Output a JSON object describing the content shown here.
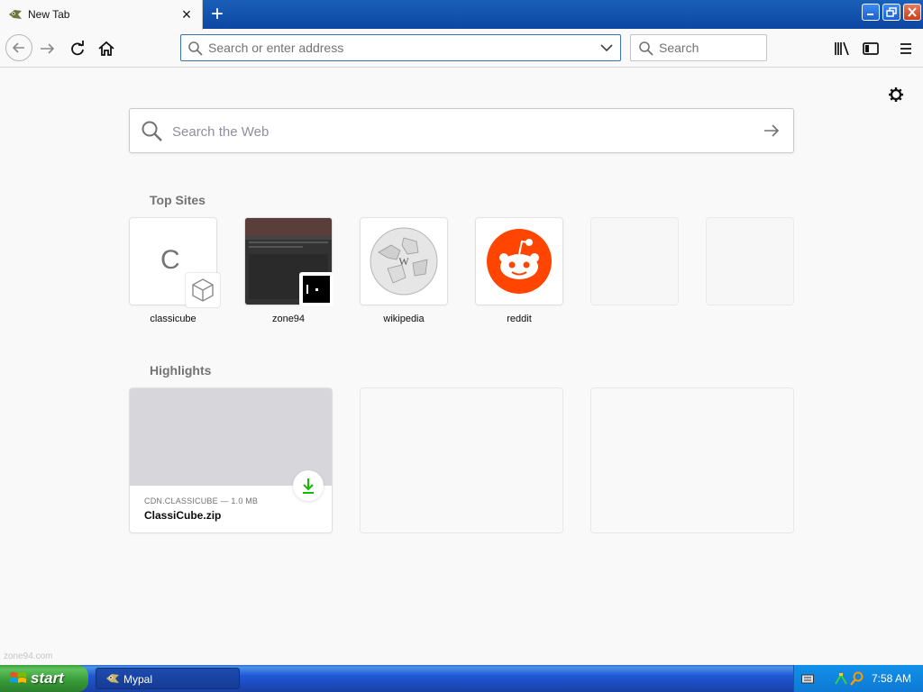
{
  "tab": {
    "title": "New Tab",
    "close_glyph": "×"
  },
  "toolbar": {
    "new_tab_glyph": "+",
    "url_placeholder": "Search or enter address",
    "search_placeholder": "Search"
  },
  "content": {
    "web_search_placeholder": "Search the Web",
    "top_sites_title": "Top Sites",
    "top_sites": [
      {
        "label": "classicube"
      },
      {
        "label": "zone94"
      },
      {
        "label": "wikipedia"
      },
      {
        "label": "reddit"
      }
    ],
    "classicube_letter": "C",
    "highlights_title": "Highlights",
    "highlight": {
      "meta": "CDN.CLASSICUBE — 1.0 MB",
      "name": "ClassiCube.zip"
    },
    "status_text": "zone94.com"
  },
  "taskbar": {
    "start_label": "start",
    "task_label": "Mypal",
    "clock": "7:58 AM"
  },
  "colors": {
    "titlebar": "#0c47a3",
    "reddit": "#ff4500",
    "download": "#12bc00",
    "taskbar": "#2157d7",
    "start": "#379837"
  },
  "icons": [
    "back-arrow-icon",
    "forward-arrow-icon",
    "reload-icon",
    "home-icon",
    "search-icon",
    "dropdown-chevron-icon",
    "library-icon",
    "sidebar-icon",
    "hamburger-menu-icon",
    "gear-icon",
    "arrow-right-icon",
    "cube-icon",
    "wikipedia-globe-icon",
    "reddit-alien-icon",
    "download-icon",
    "windows-flag-icon",
    "mypal-icon",
    "keyboard-icon",
    "network-icon"
  ]
}
